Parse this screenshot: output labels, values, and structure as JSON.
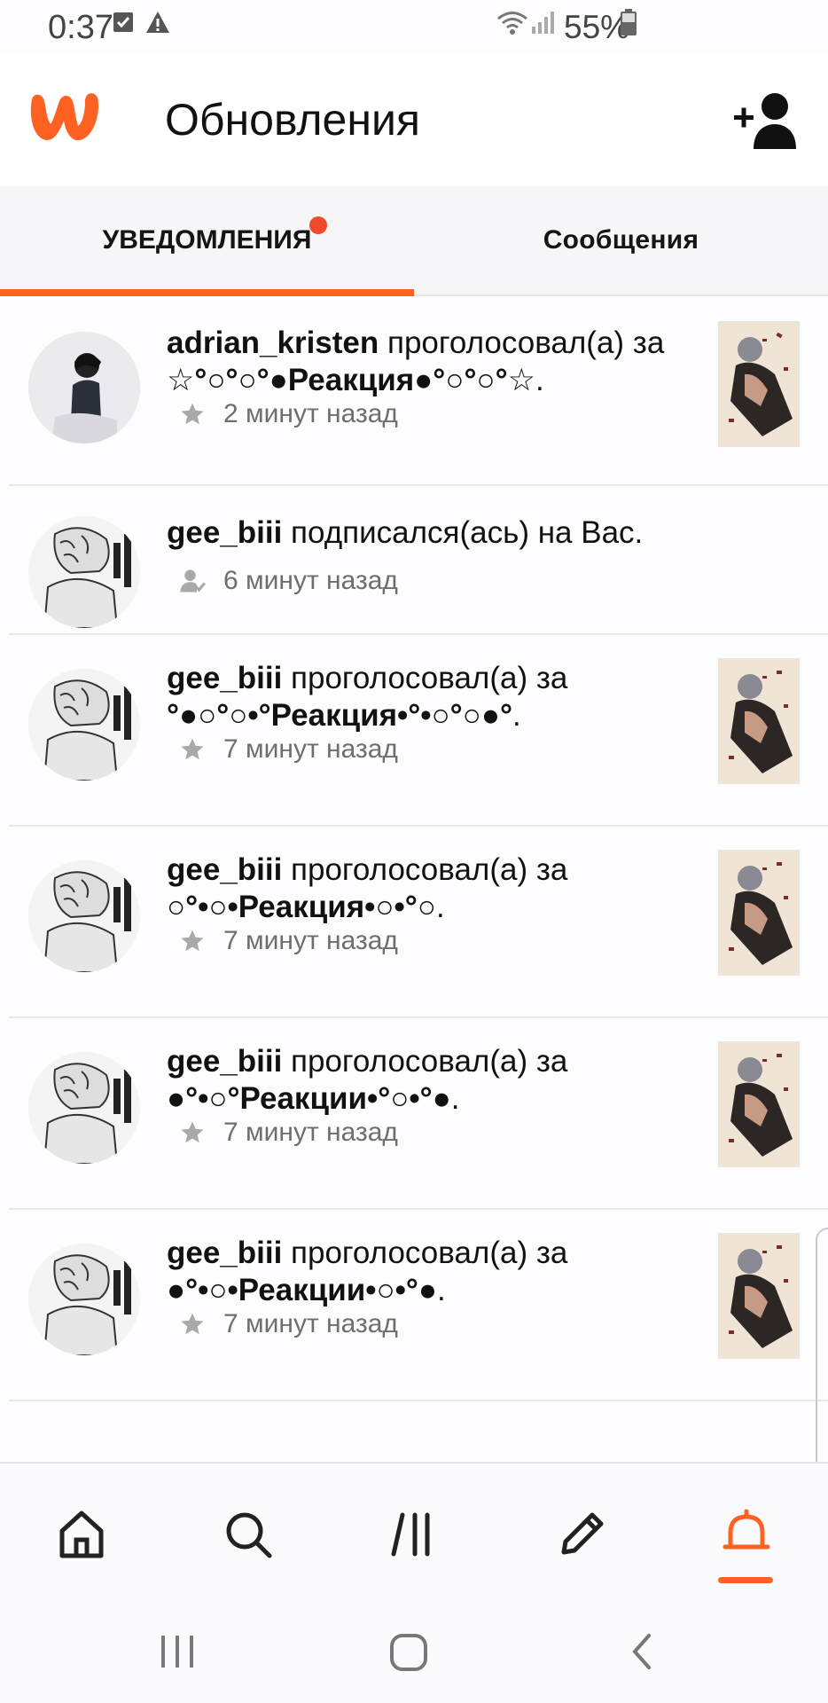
{
  "status_bar": {
    "time": "0:37",
    "battery": "55%"
  },
  "header": {
    "title": "Обновления",
    "add_user_icon": "add-user-icon",
    "logo_icon": "wattpad-logo"
  },
  "tabs": [
    {
      "label": "УВЕДОМЛЕНИЯ",
      "active": true,
      "has_badge": true
    },
    {
      "label": "Сообщения",
      "active": false
    }
  ],
  "notifications": [
    {
      "user": "adrian_kristen",
      "action": " проголосовал(а) за",
      "story": "☆°○°○°●Реакция●°○°○°☆",
      "end": ".",
      "time": "2 минут назад",
      "icon": "star-icon",
      "has_cover": true
    },
    {
      "user": "gee_biii",
      "action": " подписался(ась) на Вас.",
      "story": "",
      "end": "",
      "time": "6 минут назад",
      "icon": "follow-icon",
      "has_cover": false
    },
    {
      "user": "gee_biii",
      "action": " проголосовал(а) за",
      "story": "°●○°○•°Реакция•°•○°○●°",
      "end": ".",
      "time": "7 минут назад",
      "icon": "star-icon",
      "has_cover": true
    },
    {
      "user": "gee_biii",
      "action": " проголосовал(а) за",
      "story": "○°•○•Реакция•○•°○",
      "end": ".",
      "time": "7 минут назад",
      "icon": "star-icon",
      "has_cover": true
    },
    {
      "user": "gee_biii",
      "action": " проголосовал(а) за",
      "story": "●°•○°Реакции•°○•°●",
      "end": ".",
      "time": "7 минут назад",
      "icon": "star-icon",
      "has_cover": true
    },
    {
      "user": "gee_biii",
      "action": " проголосовал(а) за",
      "story": "●°•○•Реакции•○•°●",
      "end": ".",
      "time": "7 минут назад",
      "icon": "star-icon",
      "has_cover": true
    }
  ],
  "bottom_nav": [
    {
      "icon": "home-icon",
      "active": false
    },
    {
      "icon": "search-icon",
      "active": false
    },
    {
      "icon": "library-icon",
      "active": false
    },
    {
      "icon": "write-icon",
      "active": false
    },
    {
      "icon": "bell-icon",
      "active": true
    }
  ],
  "colors": {
    "accent": "#ff6122",
    "badge": "#ee4a2c"
  }
}
